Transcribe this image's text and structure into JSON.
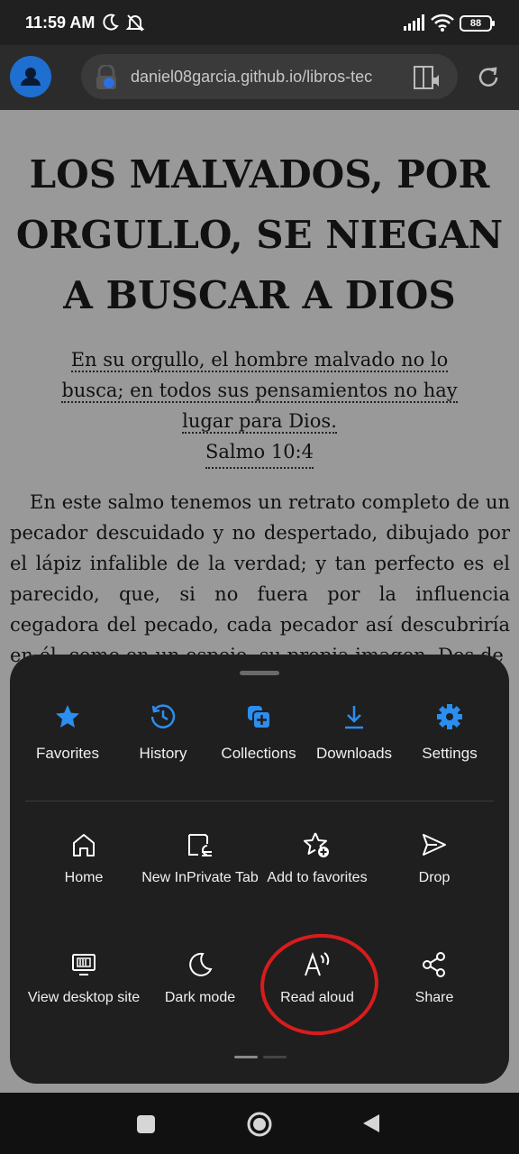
{
  "status_bar": {
    "time": "11:59 AM",
    "battery": "88",
    "icons": [
      "moon-icon",
      "mute-icon",
      "signal-icon",
      "wifi-icon",
      "battery-icon"
    ]
  },
  "toolbar": {
    "url": "daniel08garcia.github.io/libros-tec",
    "icons": [
      "avatar-icon",
      "lock-icon",
      "reader-mode-icon",
      "refresh-icon"
    ]
  },
  "page": {
    "title": "LOS MALVADOS, POR ORGULLO, SE NIEGAN A BUSCAR A DIOS",
    "quote": "En su orgullo, el hombre malvado no lo busca; en todos sus pensamientos no hay lugar para Dios.",
    "quote_ref": "Salmo 10:4",
    "body": "En este salmo tenemos un retrato completo de un pecador descuidado y no despertado, dibujado por el lápiz infalible de la verdad; y tan perfecto es el parecido, que, si no fuera por la influencia cegadora del pecado, cada pecador así descubriría en él, como en un espejo, su propia imagen. Dos de"
  },
  "menu": {
    "top_row": [
      {
        "label": "Favorites",
        "icon": "star-icon"
      },
      {
        "label": "History",
        "icon": "history-icon"
      },
      {
        "label": "Collections",
        "icon": "collections-icon"
      },
      {
        "label": "Downloads",
        "icon": "download-icon"
      },
      {
        "label": "Settings",
        "icon": "gear-icon"
      }
    ],
    "grid": [
      {
        "label": "Home",
        "icon": "home-icon"
      },
      {
        "label": "New InPrivate Tab",
        "icon": "inprivate-tab-icon"
      },
      {
        "label": "Add to favorites",
        "icon": "add-favorite-icon"
      },
      {
        "label": "Drop",
        "icon": "send-icon"
      },
      {
        "label": "View desktop site",
        "icon": "desktop-icon"
      },
      {
        "label": "Dark mode",
        "icon": "moon-icon"
      },
      {
        "label": "Read aloud",
        "icon": "read-aloud-icon"
      },
      {
        "label": "Share",
        "icon": "share-icon"
      }
    ],
    "page_indicator": {
      "pages": 2,
      "current": 1
    }
  },
  "nav_bar": {
    "icons": [
      "recents-button",
      "home-button",
      "back-button"
    ]
  },
  "colors": {
    "accent_blue": "#2b8ef0",
    "highlight_red": "#d81c1c",
    "page_bg": "#999999",
    "sheet_bg": "#1f1f1f"
  }
}
